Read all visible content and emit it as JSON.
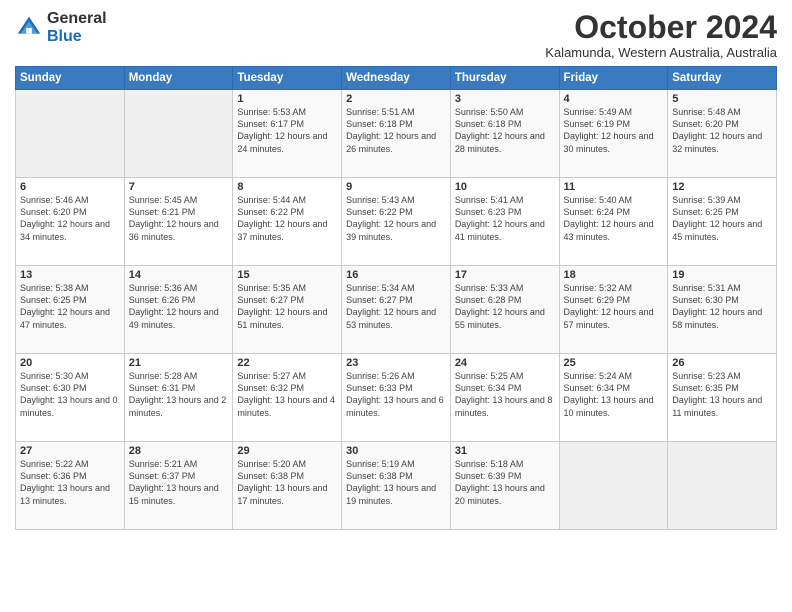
{
  "header": {
    "logo_general": "General",
    "logo_blue": "Blue",
    "title": "October 2024",
    "subtitle": "Kalamunda, Western Australia, Australia"
  },
  "weekdays": [
    "Sunday",
    "Monday",
    "Tuesday",
    "Wednesday",
    "Thursday",
    "Friday",
    "Saturday"
  ],
  "weeks": [
    [
      {
        "day": "",
        "sunrise": "",
        "sunset": "",
        "daylight": ""
      },
      {
        "day": "",
        "sunrise": "",
        "sunset": "",
        "daylight": ""
      },
      {
        "day": "1",
        "sunrise": "Sunrise: 5:53 AM",
        "sunset": "Sunset: 6:17 PM",
        "daylight": "Daylight: 12 hours and 24 minutes."
      },
      {
        "day": "2",
        "sunrise": "Sunrise: 5:51 AM",
        "sunset": "Sunset: 6:18 PM",
        "daylight": "Daylight: 12 hours and 26 minutes."
      },
      {
        "day": "3",
        "sunrise": "Sunrise: 5:50 AM",
        "sunset": "Sunset: 6:18 PM",
        "daylight": "Daylight: 12 hours and 28 minutes."
      },
      {
        "day": "4",
        "sunrise": "Sunrise: 5:49 AM",
        "sunset": "Sunset: 6:19 PM",
        "daylight": "Daylight: 12 hours and 30 minutes."
      },
      {
        "day": "5",
        "sunrise": "Sunrise: 5:48 AM",
        "sunset": "Sunset: 6:20 PM",
        "daylight": "Daylight: 12 hours and 32 minutes."
      }
    ],
    [
      {
        "day": "6",
        "sunrise": "Sunrise: 5:46 AM",
        "sunset": "Sunset: 6:20 PM",
        "daylight": "Daylight: 12 hours and 34 minutes."
      },
      {
        "day": "7",
        "sunrise": "Sunrise: 5:45 AM",
        "sunset": "Sunset: 6:21 PM",
        "daylight": "Daylight: 12 hours and 36 minutes."
      },
      {
        "day": "8",
        "sunrise": "Sunrise: 5:44 AM",
        "sunset": "Sunset: 6:22 PM",
        "daylight": "Daylight: 12 hours and 37 minutes."
      },
      {
        "day": "9",
        "sunrise": "Sunrise: 5:43 AM",
        "sunset": "Sunset: 6:22 PM",
        "daylight": "Daylight: 12 hours and 39 minutes."
      },
      {
        "day": "10",
        "sunrise": "Sunrise: 5:41 AM",
        "sunset": "Sunset: 6:23 PM",
        "daylight": "Daylight: 12 hours and 41 minutes."
      },
      {
        "day": "11",
        "sunrise": "Sunrise: 5:40 AM",
        "sunset": "Sunset: 6:24 PM",
        "daylight": "Daylight: 12 hours and 43 minutes."
      },
      {
        "day": "12",
        "sunrise": "Sunrise: 5:39 AM",
        "sunset": "Sunset: 6:25 PM",
        "daylight": "Daylight: 12 hours and 45 minutes."
      }
    ],
    [
      {
        "day": "13",
        "sunrise": "Sunrise: 5:38 AM",
        "sunset": "Sunset: 6:25 PM",
        "daylight": "Daylight: 12 hours and 47 minutes."
      },
      {
        "day": "14",
        "sunrise": "Sunrise: 5:36 AM",
        "sunset": "Sunset: 6:26 PM",
        "daylight": "Daylight: 12 hours and 49 minutes."
      },
      {
        "day": "15",
        "sunrise": "Sunrise: 5:35 AM",
        "sunset": "Sunset: 6:27 PM",
        "daylight": "Daylight: 12 hours and 51 minutes."
      },
      {
        "day": "16",
        "sunrise": "Sunrise: 5:34 AM",
        "sunset": "Sunset: 6:27 PM",
        "daylight": "Daylight: 12 hours and 53 minutes."
      },
      {
        "day": "17",
        "sunrise": "Sunrise: 5:33 AM",
        "sunset": "Sunset: 6:28 PM",
        "daylight": "Daylight: 12 hours and 55 minutes."
      },
      {
        "day": "18",
        "sunrise": "Sunrise: 5:32 AM",
        "sunset": "Sunset: 6:29 PM",
        "daylight": "Daylight: 12 hours and 57 minutes."
      },
      {
        "day": "19",
        "sunrise": "Sunrise: 5:31 AM",
        "sunset": "Sunset: 6:30 PM",
        "daylight": "Daylight: 12 hours and 58 minutes."
      }
    ],
    [
      {
        "day": "20",
        "sunrise": "Sunrise: 5:30 AM",
        "sunset": "Sunset: 6:30 PM",
        "daylight": "Daylight: 13 hours and 0 minutes."
      },
      {
        "day": "21",
        "sunrise": "Sunrise: 5:28 AM",
        "sunset": "Sunset: 6:31 PM",
        "daylight": "Daylight: 13 hours and 2 minutes."
      },
      {
        "day": "22",
        "sunrise": "Sunrise: 5:27 AM",
        "sunset": "Sunset: 6:32 PM",
        "daylight": "Daylight: 13 hours and 4 minutes."
      },
      {
        "day": "23",
        "sunrise": "Sunrise: 5:26 AM",
        "sunset": "Sunset: 6:33 PM",
        "daylight": "Daylight: 13 hours and 6 minutes."
      },
      {
        "day": "24",
        "sunrise": "Sunrise: 5:25 AM",
        "sunset": "Sunset: 6:34 PM",
        "daylight": "Daylight: 13 hours and 8 minutes."
      },
      {
        "day": "25",
        "sunrise": "Sunrise: 5:24 AM",
        "sunset": "Sunset: 6:34 PM",
        "daylight": "Daylight: 13 hours and 10 minutes."
      },
      {
        "day": "26",
        "sunrise": "Sunrise: 5:23 AM",
        "sunset": "Sunset: 6:35 PM",
        "daylight": "Daylight: 13 hours and 11 minutes."
      }
    ],
    [
      {
        "day": "27",
        "sunrise": "Sunrise: 5:22 AM",
        "sunset": "Sunset: 6:36 PM",
        "daylight": "Daylight: 13 hours and 13 minutes."
      },
      {
        "day": "28",
        "sunrise": "Sunrise: 5:21 AM",
        "sunset": "Sunset: 6:37 PM",
        "daylight": "Daylight: 13 hours and 15 minutes."
      },
      {
        "day": "29",
        "sunrise": "Sunrise: 5:20 AM",
        "sunset": "Sunset: 6:38 PM",
        "daylight": "Daylight: 13 hours and 17 minutes."
      },
      {
        "day": "30",
        "sunrise": "Sunrise: 5:19 AM",
        "sunset": "Sunset: 6:38 PM",
        "daylight": "Daylight: 13 hours and 19 minutes."
      },
      {
        "day": "31",
        "sunrise": "Sunrise: 5:18 AM",
        "sunset": "Sunset: 6:39 PM",
        "daylight": "Daylight: 13 hours and 20 minutes."
      },
      {
        "day": "",
        "sunrise": "",
        "sunset": "",
        "daylight": ""
      },
      {
        "day": "",
        "sunrise": "",
        "sunset": "",
        "daylight": ""
      }
    ]
  ]
}
